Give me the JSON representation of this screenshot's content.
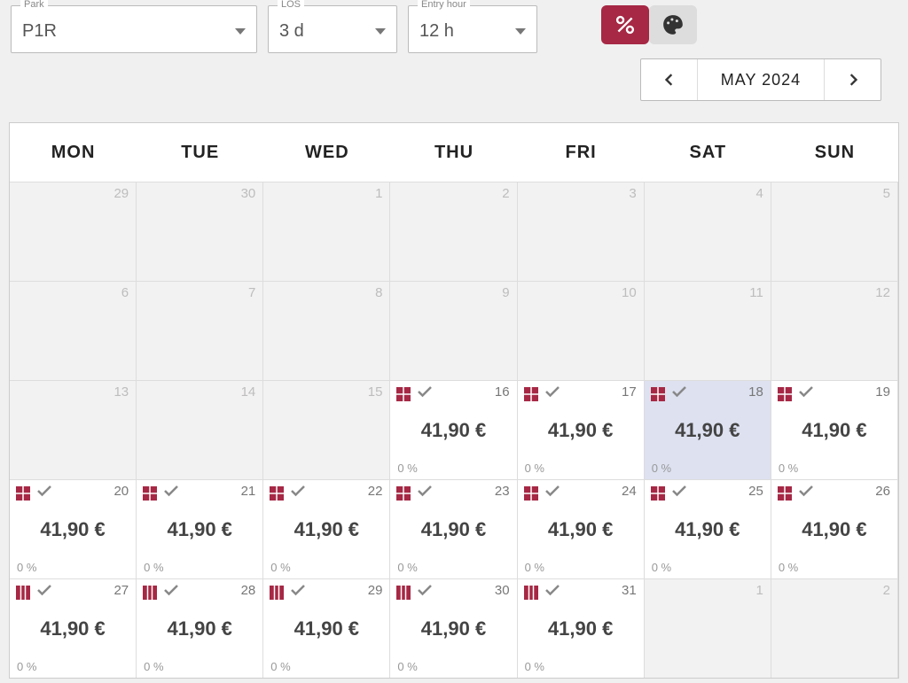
{
  "filters": {
    "park": {
      "label": "Park",
      "value": "P1R"
    },
    "los": {
      "label": "LOS",
      "value": "3 d"
    },
    "entry": {
      "label": "Entry hour",
      "value": "12 h"
    }
  },
  "toggle": {
    "active": "percent"
  },
  "monthNav": {
    "label": "MAY 2024"
  },
  "weekdays": [
    "MON",
    "TUE",
    "WED",
    "THU",
    "FRI",
    "SAT",
    "SUN"
  ],
  "colors": {
    "accent": "#a62845"
  },
  "cells": [
    {
      "num": "29",
      "muted": true,
      "filled": false
    },
    {
      "num": "30",
      "muted": true,
      "filled": false
    },
    {
      "num": "1",
      "muted": true,
      "filled": false
    },
    {
      "num": "2",
      "muted": true,
      "filled": false
    },
    {
      "num": "3",
      "muted": true,
      "filled": false
    },
    {
      "num": "4",
      "muted": true,
      "filled": false
    },
    {
      "num": "5",
      "muted": true,
      "filled": false
    },
    {
      "num": "6",
      "muted": true,
      "filled": false
    },
    {
      "num": "7",
      "muted": true,
      "filled": false
    },
    {
      "num": "8",
      "muted": true,
      "filled": false
    },
    {
      "num": "9",
      "muted": true,
      "filled": false
    },
    {
      "num": "10",
      "muted": true,
      "filled": false
    },
    {
      "num": "11",
      "muted": true,
      "filled": false
    },
    {
      "num": "12",
      "muted": true,
      "filled": false
    },
    {
      "num": "13",
      "muted": true,
      "filled": false
    },
    {
      "num": "14",
      "muted": true,
      "filled": false
    },
    {
      "num": "15",
      "muted": true,
      "filled": false
    },
    {
      "num": "16",
      "filled": true,
      "price": "41,90 €",
      "pct": "0 %",
      "icon": "grid"
    },
    {
      "num": "17",
      "filled": true,
      "price": "41,90 €",
      "pct": "0 %",
      "icon": "grid"
    },
    {
      "num": "18",
      "filled": true,
      "highlight": true,
      "price": "41,90 €",
      "pct": "0 %",
      "icon": "grid"
    },
    {
      "num": "19",
      "filled": true,
      "price": "41,90 €",
      "pct": "0 %",
      "icon": "grid"
    },
    {
      "num": "20",
      "filled": true,
      "price": "41,90 €",
      "pct": "0 %",
      "icon": "grid"
    },
    {
      "num": "21",
      "filled": true,
      "price": "41,90 €",
      "pct": "0 %",
      "icon": "grid"
    },
    {
      "num": "22",
      "filled": true,
      "price": "41,90 €",
      "pct": "0 %",
      "icon": "grid"
    },
    {
      "num": "23",
      "filled": true,
      "price": "41,90 €",
      "pct": "0 %",
      "icon": "grid"
    },
    {
      "num": "24",
      "filled": true,
      "price": "41,90 €",
      "pct": "0 %",
      "icon": "grid"
    },
    {
      "num": "25",
      "filled": true,
      "price": "41,90 €",
      "pct": "0 %",
      "icon": "grid"
    },
    {
      "num": "26",
      "filled": true,
      "price": "41,90 €",
      "pct": "0 %",
      "icon": "grid"
    },
    {
      "num": "27",
      "filled": true,
      "price": "41,90 €",
      "pct": "0 %",
      "icon": "col"
    },
    {
      "num": "28",
      "filled": true,
      "price": "41,90 €",
      "pct": "0 %",
      "icon": "col"
    },
    {
      "num": "29",
      "filled": true,
      "price": "41,90 €",
      "pct": "0 %",
      "icon": "col"
    },
    {
      "num": "30",
      "filled": true,
      "price": "41,90 €",
      "pct": "0 %",
      "icon": "col"
    },
    {
      "num": "31",
      "filled": true,
      "price": "41,90 €",
      "pct": "0 %",
      "icon": "col"
    },
    {
      "num": "1",
      "muted": true,
      "filled": false
    },
    {
      "num": "2",
      "muted": true,
      "filled": false
    }
  ]
}
